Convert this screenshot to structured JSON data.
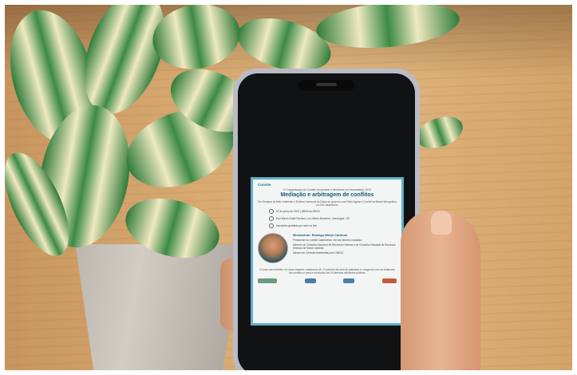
{
  "scene": {
    "description_colors": {
      "wood": "#d8aa72",
      "leaf_green": "#2f7a3a",
      "leaf_cream": "#efe9c0",
      "card_border": "#5fb0c8"
    }
  },
  "invitation": {
    "org": "Convite",
    "subtitle": "1ª Capacitação do Comitê Humanizar e Mulheres no Humanitário 2023",
    "title": "Mediação e arbitragem de conflitos",
    "intro": "Em Semana do Meio Ambiente e Direitos Humanos do Diário do governo com Rolfo Aguiar e Comitê da Bacia Hidrográfica do Sul Catarinense",
    "date": "07 de junho de 2023 | 08h00 às 09h00",
    "location": "Rua Mauro Gaba Pacheco, s/n, Bairro Bandeira - Araranguá - SC",
    "registration": "Inscrições gratuitas por meio do link",
    "speaker_name": "Ministrante: Rodrigo Wolpi Cardoso",
    "bullets": [
      "Presidente do Comitê Catarinense, em seu terceiro mandato;",
      "Membro do Conselho Nacional de Recursos Hídricos e do Conselho Estadual de Recursos Hídricos de Santa Catarina.",
      "Mestre em Ciências Ambientais pela UNESC."
    ],
    "footer_note": "O curso será dividido em duas metades, totalizando 4h. O primeiro dia será de palestras e o segundo com as dinâmicas dos conflitos e para a conclusão das 4h faremos atividades práticas."
  }
}
